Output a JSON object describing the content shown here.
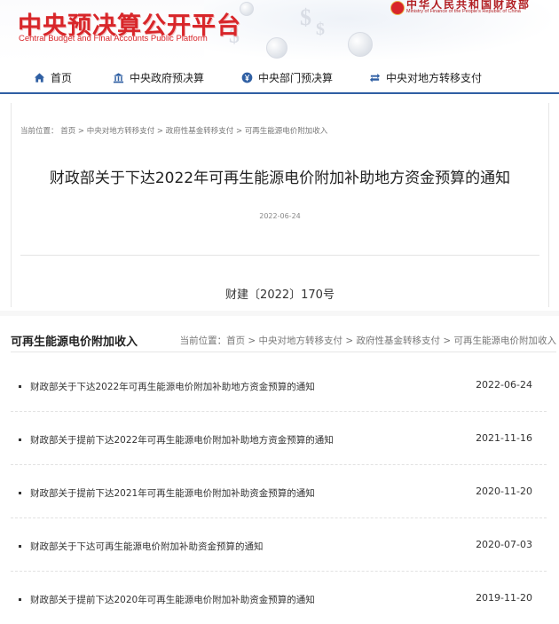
{
  "header": {
    "site_title": "中央预决算公开平台",
    "site_subtitle": "Central Budget and Final Accounts Public Platform",
    "ministry_cn": "中华人民共和国财政部",
    "ministry_en": "Ministry of Finance of the People's Republic of China"
  },
  "nav": {
    "items": [
      {
        "label": "首页",
        "icon": "home-icon"
      },
      {
        "label": "中央政府预决算",
        "icon": "building-icon"
      },
      {
        "label": "中央部门预决算",
        "icon": "yuan-icon"
      },
      {
        "label": "中央对地方转移支付",
        "icon": "transfer-icon"
      }
    ]
  },
  "article": {
    "breadcrumb": "当前位置： 首页 > 中央对地方转移支付 > 政府性基金转移支付 > 可再生能源电价附加收入",
    "title": "财政部关于下达2022年可再生能源电价附加补助地方资金预算的通知",
    "date": "2022-06-24",
    "doc_number": "财建〔2022〕170号"
  },
  "list": {
    "section_title": "可再生能源电价附加收入",
    "breadcrumb": "当前位置：首页 > 中央对地方转移支付 > 政府性基金转移支付 > 可再生能源电价附加收入",
    "items": [
      {
        "title": "财政部关于下达2022年可再生能源电价附加补助地方资金预算的通知",
        "date": "2022-06-24"
      },
      {
        "title": "财政部关于提前下达2022年可再生能源电价附加补助地方资金预算的通知",
        "date": "2021-11-16"
      },
      {
        "title": "财政部关于提前下达2021年可再生能源电价附加补助资金预算的通知",
        "date": "2020-11-20"
      },
      {
        "title": "财政部关于下达可再生能源电价附加补助资金预算的通知",
        "date": "2020-07-03"
      },
      {
        "title": "财政部关于提前下达2020年可再生能源电价附加补助资金预算的通知",
        "date": "2019-11-20"
      }
    ]
  },
  "colors": {
    "brand_red": "#d8262a",
    "nav_blue": "#2f5fa3"
  }
}
